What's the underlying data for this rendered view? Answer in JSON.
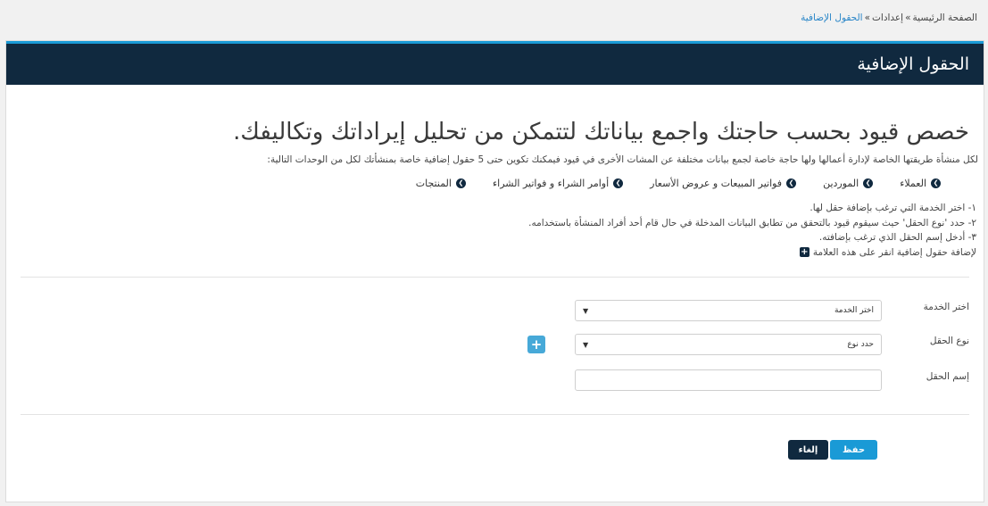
{
  "breadcrumb": {
    "home": "الصفحة الرئيسية",
    "sep1": "»",
    "settings": "إعدادات",
    "sep2": "»",
    "current": "الحقول الإضافية"
  },
  "panel": {
    "title": "الحقول الإضافية"
  },
  "headline": "خصص قيود بحسب حاجتك واجمع بياناتك لتتمكن من تحليل إيراداتك وتكاليفك.",
  "intro": "لكل منشأة طريقتها الخاصة لإدارة أعمالها ولها حاجة خاصة لجمع بيانات مختلفة عن المشات الأخرى في قيود فيمكنك تكوين حتى 5 حقول إضافية خاصة بمنشأتك لكل من الوحدات التالية:",
  "units": [
    {
      "label": "العملاء"
    },
    {
      "label": "الموردين"
    },
    {
      "label": "فواتير المبيعات و عروض الأسعار"
    },
    {
      "label": "أوامر الشراء و فواتير الشراء"
    },
    {
      "label": "المنتجات"
    }
  ],
  "steps": [
    "١- اختر الخدمة التي ترغب بإضافة حقل لها.",
    "٢- حدد 'نوع الحقل' حيث سيقوم قيود بالتحقق من تطابق البيانات المدخلة في حال قام أحد أفراد المنشأة باستخدامه.",
    "٣- أدخل إسم الحقل الذي ترغب بإضافته."
  ],
  "add_hint": "لإضافة حقول إضافية انقر على هذه العلامة",
  "form": {
    "service_label": "اختر الخدمة",
    "service_value": "اختر الخدمة",
    "type_label": "نوع الحقل",
    "type_value": "حدد نوع",
    "name_label": "إسم الحقل",
    "name_value": ""
  },
  "buttons": {
    "save": "حفظ",
    "cancel": "إلغاء"
  },
  "colors": {
    "header_bg": "#10293f",
    "accent": "#1a9ad6",
    "add_button": "#47a9d8",
    "breadcrumb_link": "#2a86c8"
  }
}
